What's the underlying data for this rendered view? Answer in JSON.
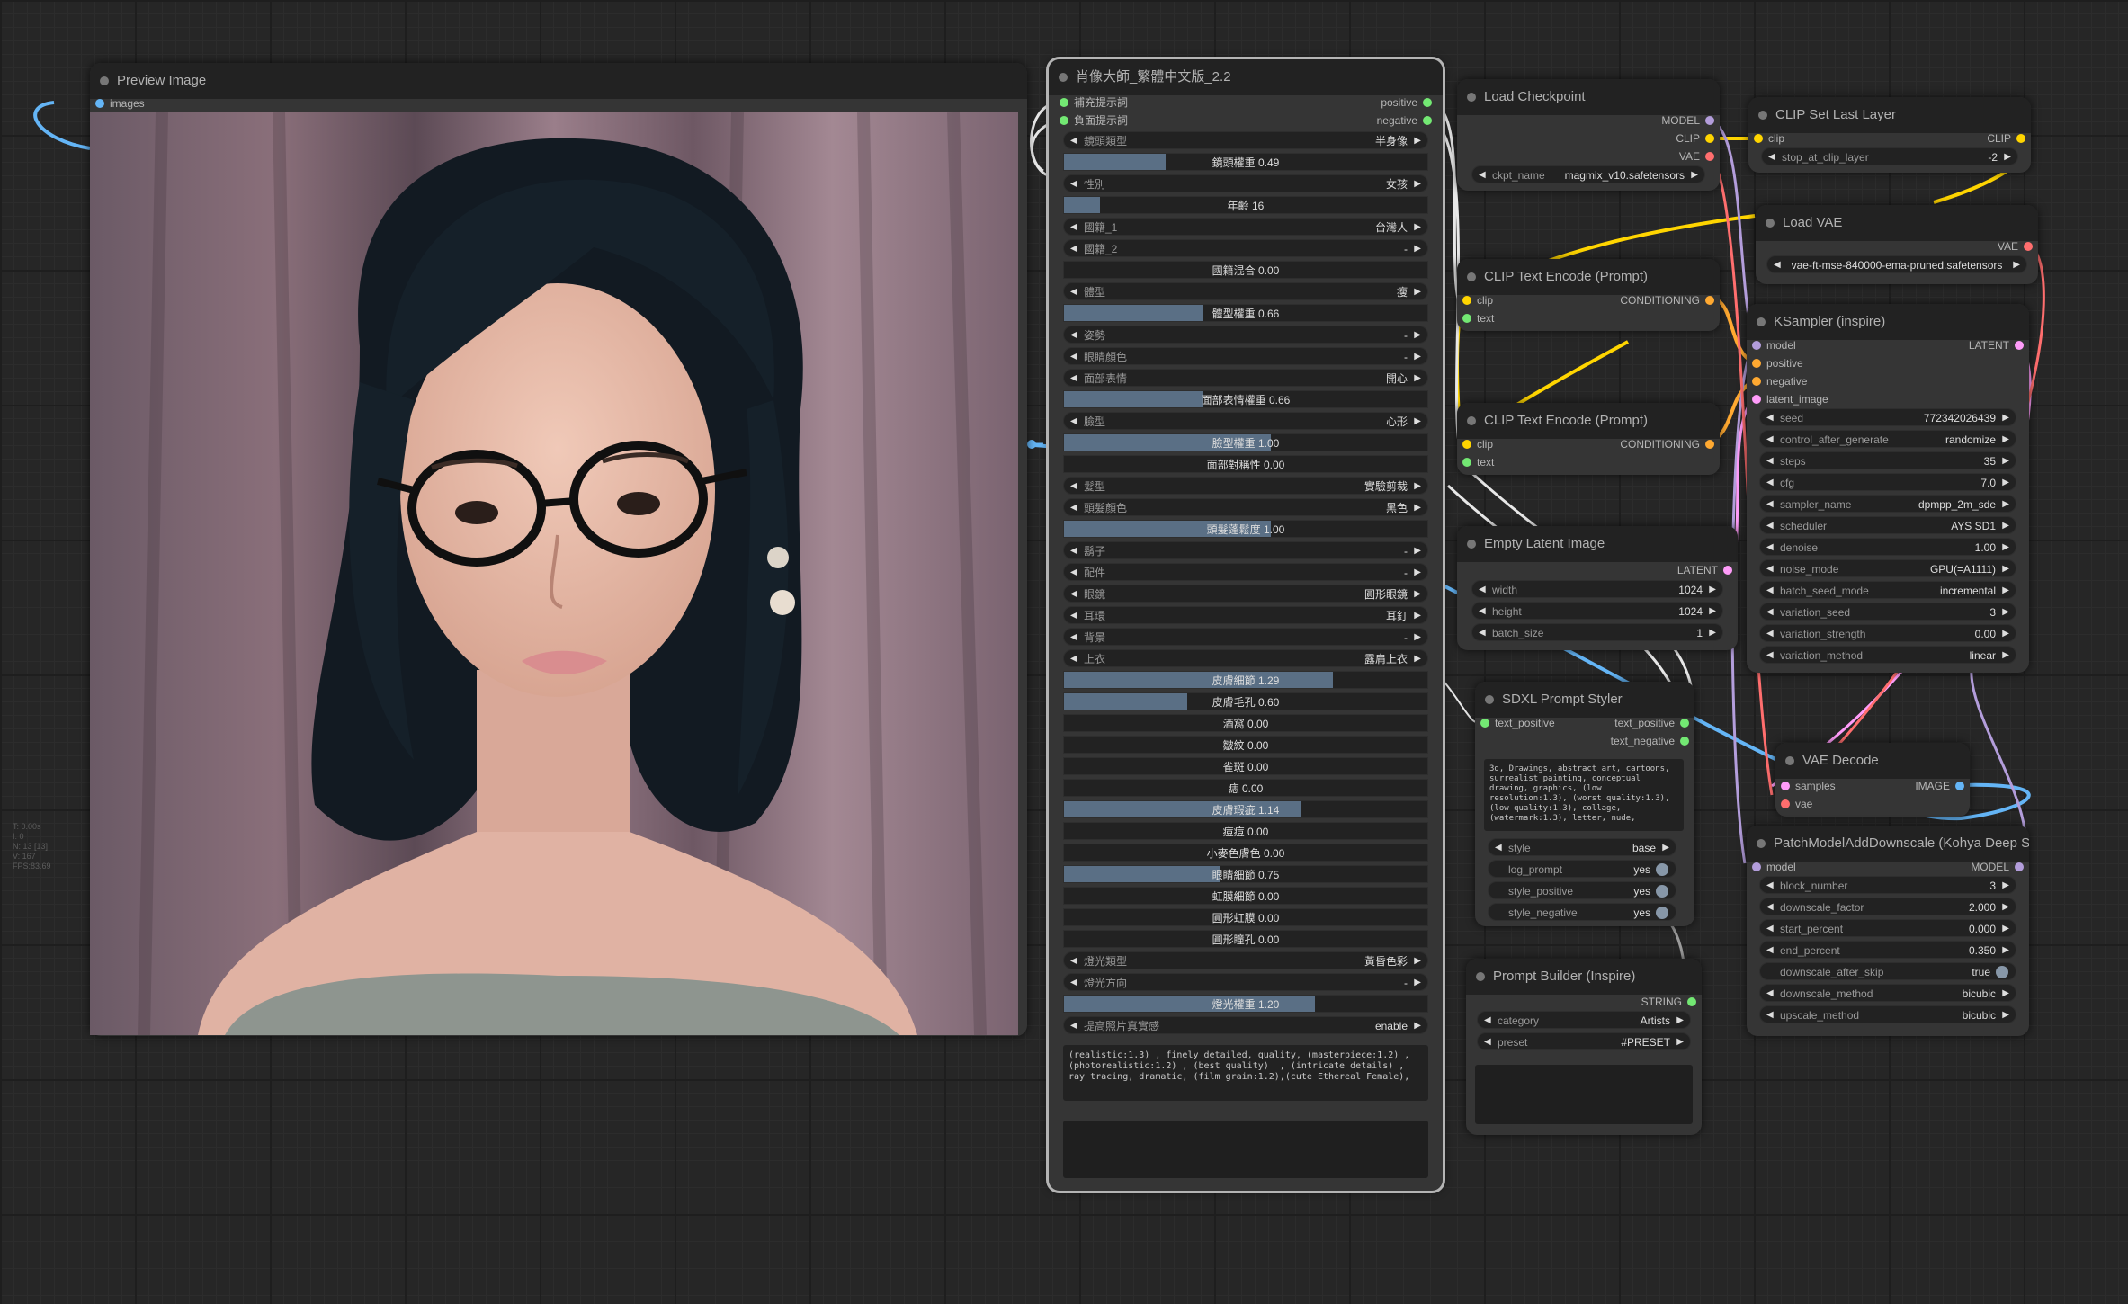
{
  "canvas_stats": [
    "T: 0.00s",
    "I: 0",
    "N: 13 [13]",
    "V: 167",
    "FPS:83.69"
  ],
  "preview_node": {
    "title": "Preview Image",
    "input_images": "images"
  },
  "portrait_node": {
    "title": "肖像大師_繁體中文版_2.2",
    "inputs": [
      "補充提示詞",
      "負面提示詞"
    ],
    "outputs": [
      "positive",
      "negative"
    ],
    "widgets": [
      {
        "type": "combo",
        "label": "鏡頭類型",
        "value": "半身像"
      },
      {
        "type": "slider",
        "label": "鏡頭權重",
        "value": "0.49",
        "fill": 0.28
      },
      {
        "type": "combo",
        "label": "性別",
        "value": "女孩"
      },
      {
        "type": "slider",
        "label": "年齡",
        "value": "16",
        "fill": 0.1
      },
      {
        "type": "combo",
        "label": "國籍_1",
        "value": "台灣人"
      },
      {
        "type": "combo",
        "label": "國籍_2",
        "value": "-"
      },
      {
        "type": "slider",
        "label": "國籍混合",
        "value": "0.00",
        "fill": 0
      },
      {
        "type": "combo",
        "label": "體型",
        "value": "瘦"
      },
      {
        "type": "slider",
        "label": "體型權重",
        "value": "0.66",
        "fill": 0.38
      },
      {
        "type": "combo",
        "label": "姿勢",
        "value": "-"
      },
      {
        "type": "combo",
        "label": "眼睛顏色",
        "value": "-"
      },
      {
        "type": "combo",
        "label": "面部表情",
        "value": "開心"
      },
      {
        "type": "slider",
        "label": "面部表情權重",
        "value": "0.66",
        "fill": 0.38
      },
      {
        "type": "combo",
        "label": "臉型",
        "value": "心形"
      },
      {
        "type": "slider",
        "label": "臉型權重",
        "value": "1.00",
        "fill": 0.57
      },
      {
        "type": "slider",
        "label": "面部對稱性",
        "value": "0.00",
        "fill": 0
      },
      {
        "type": "combo",
        "label": "髮型",
        "value": "實驗剪裁"
      },
      {
        "type": "combo",
        "label": "頭髮顏色",
        "value": "黑色"
      },
      {
        "type": "slider",
        "label": "頭髮蓬鬆度",
        "value": "1.00",
        "fill": 0.57
      },
      {
        "type": "combo",
        "label": "鬍子",
        "value": "-"
      },
      {
        "type": "combo",
        "label": "配件",
        "value": "-"
      },
      {
        "type": "combo",
        "label": "眼鏡",
        "value": "圓形眼鏡"
      },
      {
        "type": "combo",
        "label": "耳環",
        "value": "耳釘"
      },
      {
        "type": "combo",
        "label": "背景",
        "value": "-"
      },
      {
        "type": "combo",
        "label": "上衣",
        "value": "露肩上衣"
      },
      {
        "type": "slider",
        "label": "皮膚細節",
        "value": "1.29",
        "fill": 0.74
      },
      {
        "type": "slider",
        "label": "皮膚毛孔",
        "value": "0.60",
        "fill": 0.34
      },
      {
        "type": "slider",
        "label": "酒窩",
        "value": "0.00",
        "fill": 0
      },
      {
        "type": "slider",
        "label": "皺紋",
        "value": "0.00",
        "fill": 0
      },
      {
        "type": "slider",
        "label": "雀斑",
        "value": "0.00",
        "fill": 0
      },
      {
        "type": "slider",
        "label": "痣",
        "value": "0.00",
        "fill": 0
      },
      {
        "type": "slider",
        "label": "皮膚瑕疵",
        "value": "1.14",
        "fill": 0.65
      },
      {
        "type": "slider",
        "label": "痘痘",
        "value": "0.00",
        "fill": 0
      },
      {
        "type": "slider",
        "label": "小麥色膚色",
        "value": "0.00",
        "fill": 0
      },
      {
        "type": "slider",
        "label": "眼睛細節",
        "value": "0.75",
        "fill": 0.43
      },
      {
        "type": "slider",
        "label": "虹膜細節",
        "value": "0.00",
        "fill": 0
      },
      {
        "type": "slider",
        "label": "圓形虹膜",
        "value": "0.00",
        "fill": 0
      },
      {
        "type": "slider",
        "label": "圓形瞳孔",
        "value": "0.00",
        "fill": 0
      },
      {
        "type": "combo",
        "label": "燈光類型",
        "value": "黃昏色彩"
      },
      {
        "type": "combo",
        "label": "燈光方向",
        "value": "-"
      },
      {
        "type": "slider",
        "label": "燈光權重",
        "value": "1.20",
        "fill": 0.69
      },
      {
        "type": "combo",
        "label": "提高照片真實感",
        "value": "enable"
      }
    ],
    "prompt_text": "(realistic:1.3) , finely detailed, quality, (masterpiece:1.2) , (photorealistic:1.2) , (best quality)  , (intricate details) , ray tracing, dramatic, (film grain:1.2),(cute Ethereal Female),"
  },
  "load_checkpoint": {
    "title": "Load Checkpoint",
    "outputs": [
      "MODEL",
      "CLIP",
      "VAE"
    ],
    "ckpt_label": "ckpt_name",
    "ckpt_value": "magmix_v10.safetensors"
  },
  "clip_set_last_layer": {
    "title": "CLIP Set Last Layer",
    "input": "clip",
    "output": "CLIP",
    "w_label": "stop_at_clip_layer",
    "w_value": "-2"
  },
  "load_vae": {
    "title": "Load VAE",
    "output": "VAE",
    "w_value": "vae-ft-mse-840000-ema-pruned.safetensors"
  },
  "clip_text_encode_1": {
    "title": "CLIP Text Encode (Prompt)",
    "inputs": [
      "clip",
      "text"
    ],
    "output": "CONDITIONING"
  },
  "clip_text_encode_2": {
    "title": "CLIP Text Encode (Prompt)",
    "inputs": [
      "clip",
      "text"
    ],
    "output": "CONDITIONING"
  },
  "empty_latent": {
    "title": "Empty Latent Image",
    "output": "LATENT",
    "widgets": [
      {
        "label": "width",
        "value": "1024"
      },
      {
        "label": "height",
        "value": "1024"
      },
      {
        "label": "batch_size",
        "value": "1"
      }
    ]
  },
  "ksampler": {
    "title": "KSampler (inspire)",
    "inputs": [
      "model",
      "positive",
      "negative",
      "latent_image"
    ],
    "output": "LATENT",
    "widgets": [
      {
        "label": "seed",
        "value": "772342026439"
      },
      {
        "label": "control_after_generate",
        "value": "randomize"
      },
      {
        "label": "steps",
        "value": "35"
      },
      {
        "label": "cfg",
        "value": "7.0"
      },
      {
        "label": "sampler_name",
        "value": "dpmpp_2m_sde"
      },
      {
        "label": "scheduler",
        "value": "AYS SD1"
      },
      {
        "label": "denoise",
        "value": "1.00"
      },
      {
        "label": "noise_mode",
        "value": "GPU(=A1111)"
      },
      {
        "label": "batch_seed_mode",
        "value": "incremental"
      },
      {
        "label": "variation_seed",
        "value": "3"
      },
      {
        "label": "variation_strength",
        "value": "0.00"
      },
      {
        "label": "variation_method",
        "value": "linear"
      }
    ]
  },
  "sdxl_styler": {
    "title": "SDXL Prompt Styler",
    "input": "text_positive",
    "outputs": [
      "text_positive",
      "text_negative"
    ],
    "text": "3d, Drawings, abstract art, cartoons, surrealist painting, conceptual drawing, graphics, (low resolution:1.3), (worst quality:1.3), (low quality:1.3), collage, (watermark:1.3), letter, nude,",
    "widgets": [
      {
        "type": "combo",
        "label": "style",
        "value": "base"
      },
      {
        "type": "toggle",
        "label": "log_prompt",
        "value": "yes"
      },
      {
        "type": "toggle",
        "label": "style_positive",
        "value": "yes"
      },
      {
        "type": "toggle",
        "label": "style_negative",
        "value": "yes"
      }
    ]
  },
  "vae_decode": {
    "title": "VAE Decode",
    "inputs": [
      "samples",
      "vae"
    ],
    "output": "IMAGE"
  },
  "patch_model": {
    "title": "PatchModelAddDownscale (Kohya Deep Shrink)",
    "input": "model",
    "output": "MODEL",
    "widgets": [
      {
        "type": "number",
        "label": "block_number",
        "value": "3"
      },
      {
        "type": "number",
        "label": "downscale_factor",
        "value": "2.000"
      },
      {
        "type": "number",
        "label": "start_percent",
        "value": "0.000"
      },
      {
        "type": "number",
        "label": "end_percent",
        "value": "0.350"
      },
      {
        "type": "toggle",
        "label": "downscale_after_skip",
        "value": "true"
      },
      {
        "type": "combo",
        "label": "downscale_method",
        "value": "bicubic"
      },
      {
        "type": "combo",
        "label": "upscale_method",
        "value": "bicubic"
      }
    ]
  },
  "prompt_builder": {
    "title": "Prompt Builder (Inspire)",
    "output": "STRING",
    "widgets": [
      {
        "label": "category",
        "value": "Artists"
      },
      {
        "label": "preset",
        "value": "#PRESET"
      }
    ]
  },
  "colors": {
    "node_bg": "#353535",
    "header_bg": "#222222",
    "clip_link": "#ffd500",
    "conditioning": "#ffa931",
    "latent": "#ff9cf9",
    "model": "#b39ddb",
    "vae": "#ff6e6e",
    "image": "#64b5f6",
    "string": "#73e873"
  }
}
